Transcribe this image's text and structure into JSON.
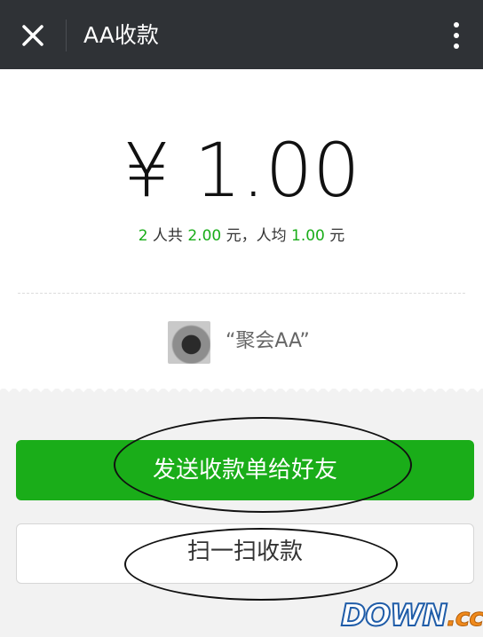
{
  "topbar": {
    "title": "AA收款",
    "close_icon": "close-icon",
    "more_icon": "more-vertical-icon"
  },
  "payment": {
    "amount": "¥ 1.00",
    "people": "2",
    "people_suffix": " 人共 ",
    "total": "2.00",
    "total_suffix": " 元，人均 ",
    "average": "1.00",
    "average_suffix": " 元",
    "note": "“聚会AA”",
    "accent_color": "#1aad19"
  },
  "actions": {
    "send_label": "发送收款单给好友",
    "scan_label": "扫一扫收款"
  },
  "watermark": {
    "down": "DOWN",
    "cc": ".cc"
  }
}
